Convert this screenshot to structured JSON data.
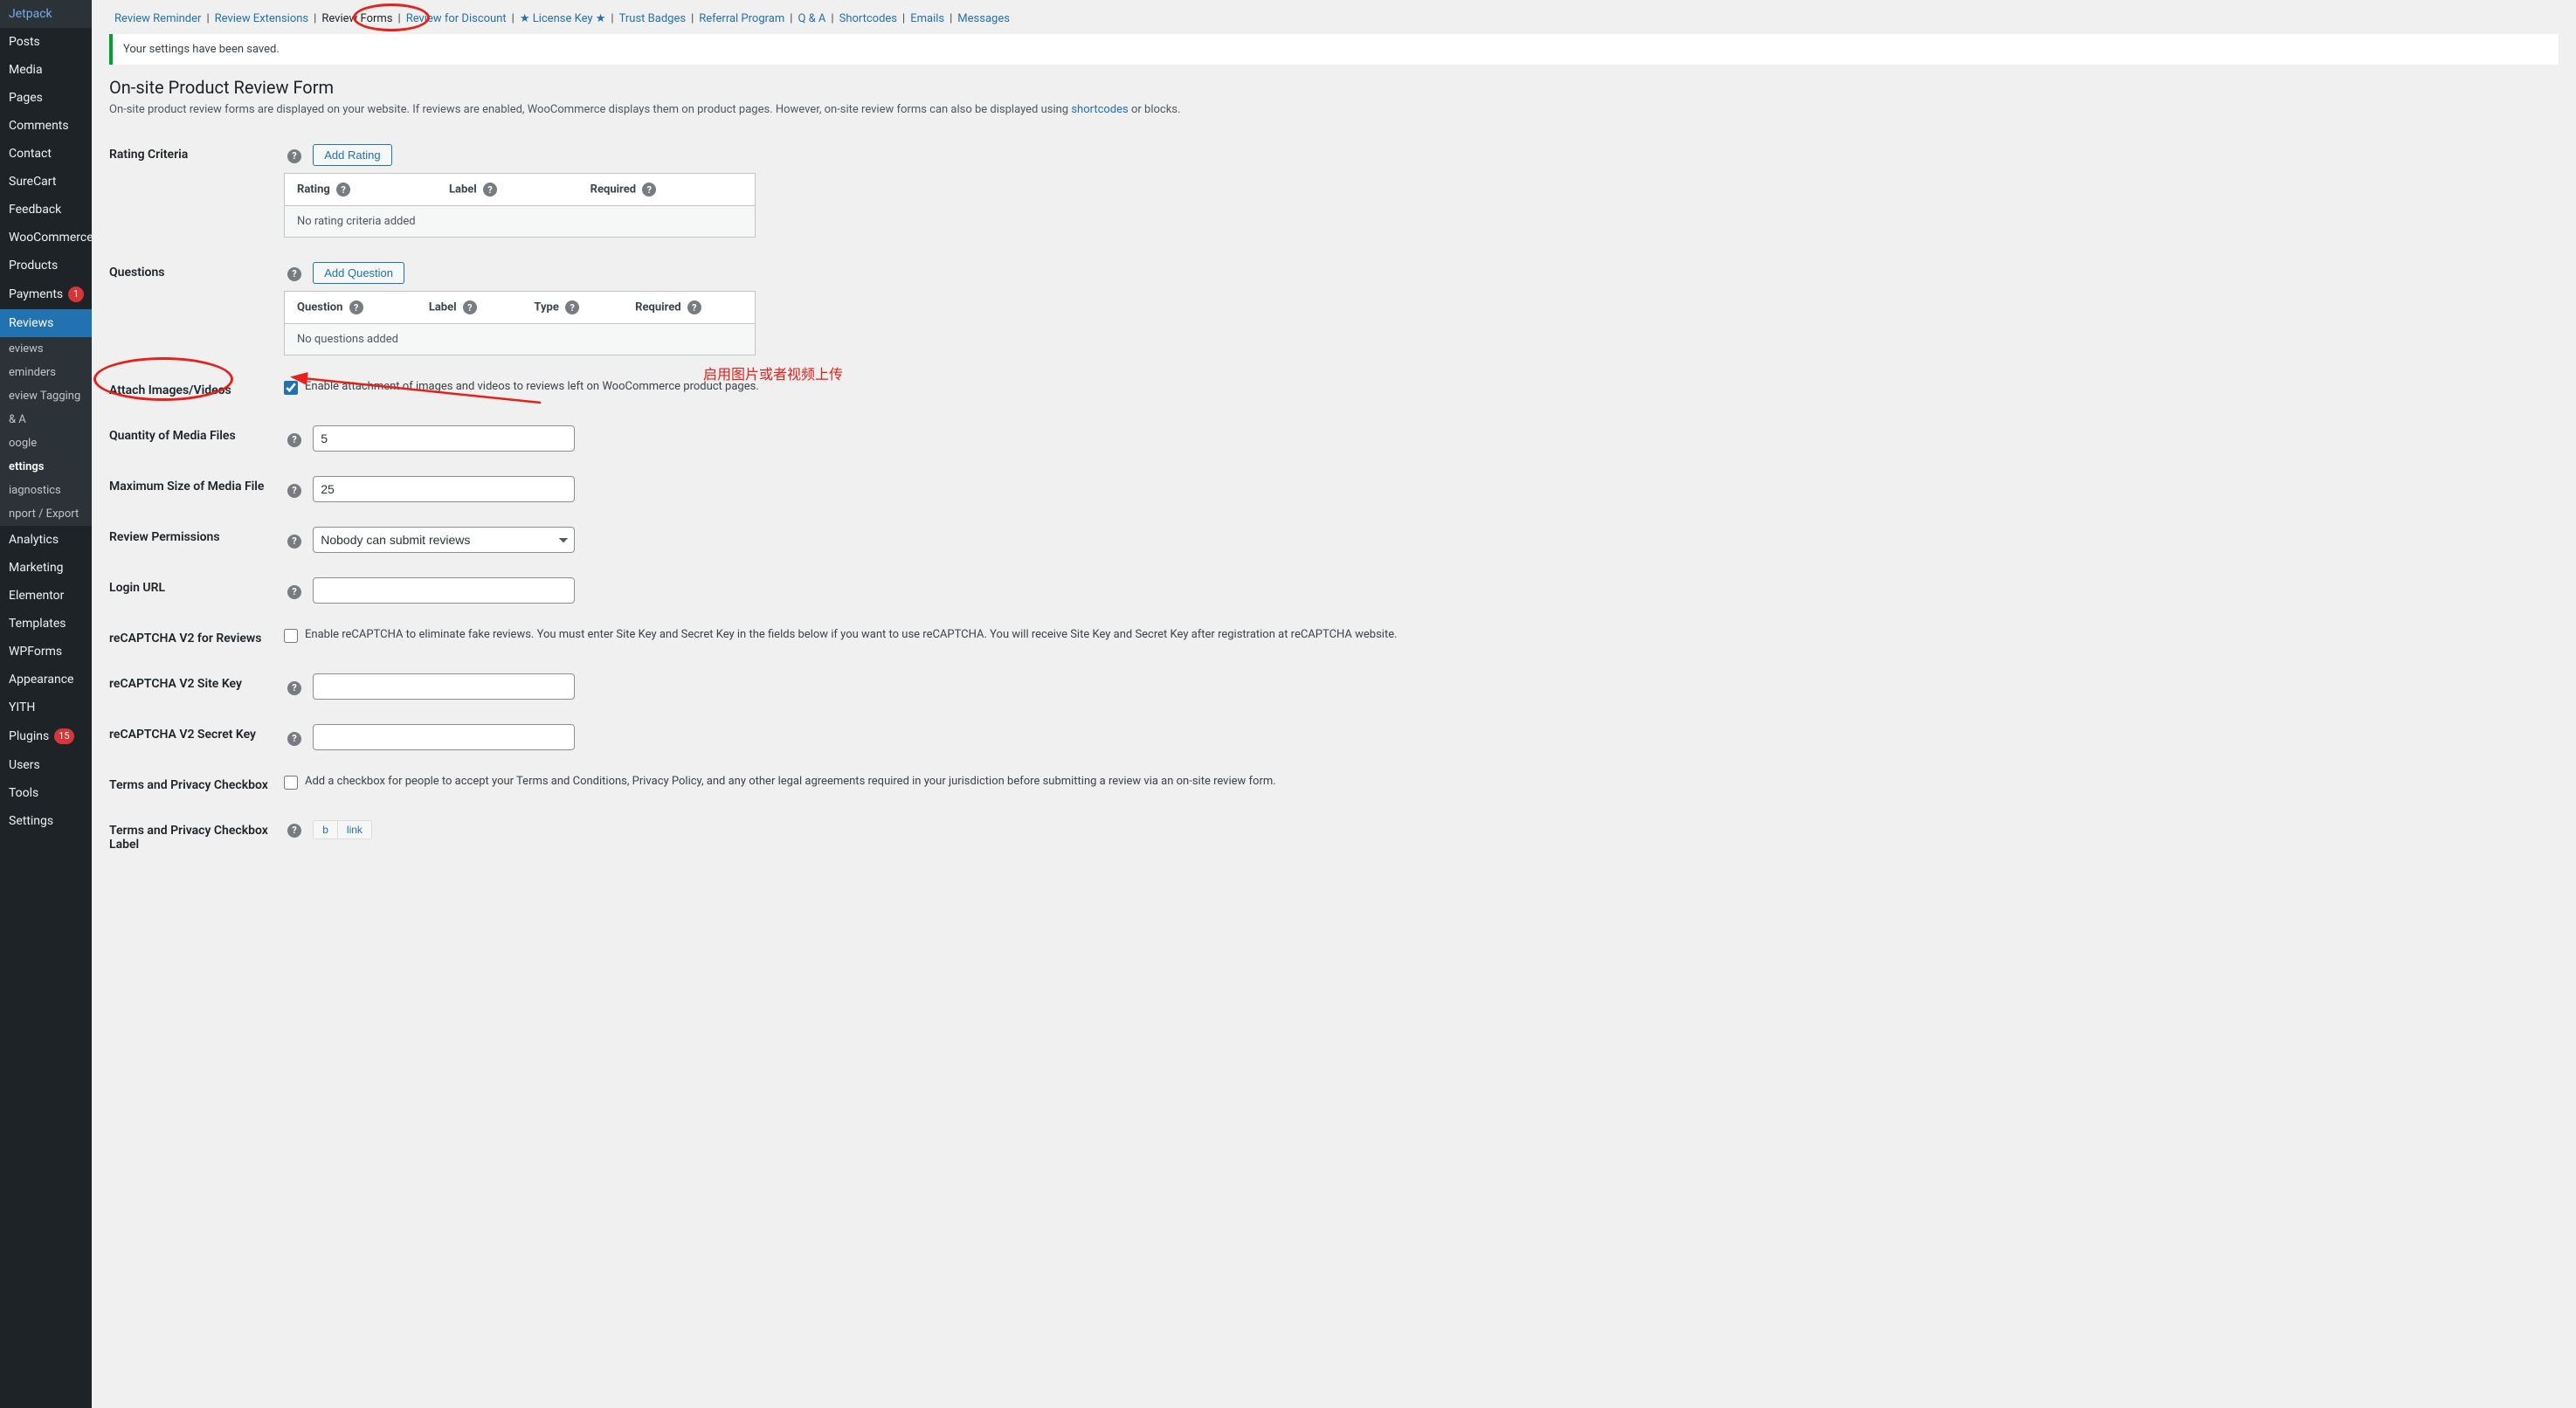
{
  "sidebar": {
    "items": [
      {
        "label": "Jetpack"
      },
      {
        "label": "Posts"
      },
      {
        "label": "Media"
      },
      {
        "label": "Pages"
      },
      {
        "label": "Comments"
      },
      {
        "label": "Contact"
      },
      {
        "label": "SureCart"
      },
      {
        "label": "Feedback"
      },
      {
        "label": "WooCommerce"
      },
      {
        "label": "Products"
      },
      {
        "label": "Payments",
        "badge": "1"
      },
      {
        "label": "Reviews",
        "current": true
      },
      {
        "label": "Analytics"
      },
      {
        "label": "Marketing"
      },
      {
        "label": "Elementor"
      },
      {
        "label": "Templates"
      },
      {
        "label": "WPForms"
      },
      {
        "label": "Appearance"
      },
      {
        "label": "YITH"
      },
      {
        "label": "Plugins",
        "badge": "15"
      },
      {
        "label": "Users"
      },
      {
        "label": "Tools"
      },
      {
        "label": "Settings"
      }
    ],
    "sub": [
      {
        "label": "eviews"
      },
      {
        "label": "eminders"
      },
      {
        "label": "eview Tagging"
      },
      {
        "label": " & A"
      },
      {
        "label": "oogle"
      },
      {
        "label": "ettings",
        "active": true
      },
      {
        "label": "iagnostics"
      },
      {
        "label": "nport / Export"
      }
    ]
  },
  "tabs": [
    {
      "label": "Review Reminder"
    },
    {
      "label": "Review Extensions"
    },
    {
      "label": "Review Forms",
      "current": true
    },
    {
      "label": "Review for Discount"
    },
    {
      "label": "★ License Key ★"
    },
    {
      "label": "Trust Badges"
    },
    {
      "label": "Referral Program"
    },
    {
      "label": "Q & A"
    },
    {
      "label": "Shortcodes"
    },
    {
      "label": "Emails"
    },
    {
      "label": "Messages"
    }
  ],
  "notice": "Your settings have been saved.",
  "section": {
    "title": "On-site Product Review Form",
    "desc_pre": "On-site product review forms are displayed on your website. If reviews are enabled, WooCommerce displays them on product pages. However, on-site review forms can also be displayed using ",
    "desc_link": "shortcodes",
    "desc_post": " or blocks."
  },
  "fields": {
    "rating_criteria": {
      "label": "Rating Criteria",
      "button": "Add Rating",
      "headers": [
        "Rating",
        "Label",
        "Required"
      ],
      "empty": "No rating criteria added"
    },
    "questions": {
      "label": "Questions",
      "button": "Add Question",
      "headers": [
        "Question",
        "Label",
        "Type",
        "Required"
      ],
      "empty": "No questions added"
    },
    "attach": {
      "label": "Attach Images/Videos",
      "desc": "Enable attachment of images and videos to reviews left on WooCommerce product pages.",
      "checked": true
    },
    "qty": {
      "label": "Quantity of Media Files",
      "value": "5"
    },
    "maxsize": {
      "label": "Maximum Size of Media File",
      "value": "25"
    },
    "perm": {
      "label": "Review Permissions",
      "value": "Nobody can submit reviews"
    },
    "login": {
      "label": "Login URL",
      "value": ""
    },
    "recap": {
      "label": "reCAPTCHA V2 for Reviews",
      "desc": "Enable reCAPTCHA to eliminate fake reviews. You must enter Site Key and Secret Key in the fields below if you want to use reCAPTCHA. You will receive Site Key and Secret Key after registration at reCAPTCHA website.",
      "checked": false
    },
    "sitekey": {
      "label": "reCAPTCHA V2 Site Key",
      "value": ""
    },
    "secretkey": {
      "label": "reCAPTCHA V2 Secret Key",
      "value": ""
    },
    "terms": {
      "label": "Terms and Privacy Checkbox",
      "desc": "Add a checkbox for people to accept your Terms and Conditions, Privacy Policy, and any other legal agreements required in your jurisdiction before submitting a review via an on-site review form.",
      "checked": false
    },
    "terms_label": {
      "label": "Terms and Privacy Checkbox Label",
      "btns": [
        "b",
        "link"
      ]
    }
  },
  "annotation": {
    "text": "启用图片或者视频上传"
  }
}
